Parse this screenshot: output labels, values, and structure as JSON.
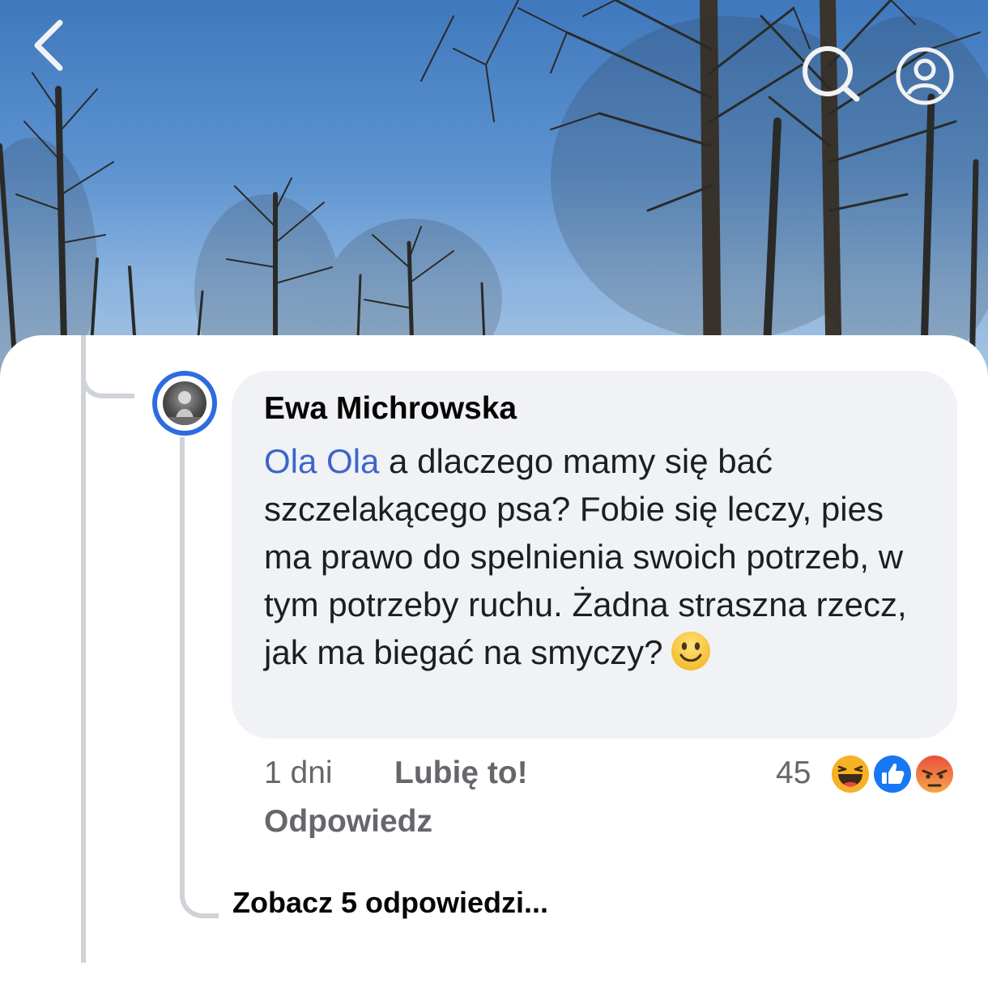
{
  "header": {
    "back_icon": "chevron-left-icon",
    "search_icon": "search-icon",
    "profile_icon": "profile-icon"
  },
  "comment": {
    "author": "Ewa Michrowska",
    "mention": "Ola Ola",
    "text": " a dlaczego mamy się bać szczelakącego psa? Fobie się leczy, pies ma prawo do spelnienia swoich potrzeb, w tym potrzeby ruchu. Żadna straszna rzecz, jak ma biegać na smyczy?",
    "emoji": "slightly-smiling-face",
    "time": "1 dni",
    "like_label": "Lubię to!",
    "reply_label": "Odpowiedz",
    "reactions": {
      "count": "45",
      "types": [
        "haha",
        "like",
        "angry"
      ]
    }
  },
  "replies": {
    "see_more_label": "Zobacz 5 odpowiedzi..."
  },
  "colors": {
    "mention": "#3b66c9",
    "avatar_ring": "#2d6be0",
    "bubble_bg": "#f0f2f5",
    "meta_text": "#65676b",
    "like_reaction": "#1877f2",
    "angry_reaction": "#e9503a",
    "haha_reaction": "#f7b125"
  }
}
